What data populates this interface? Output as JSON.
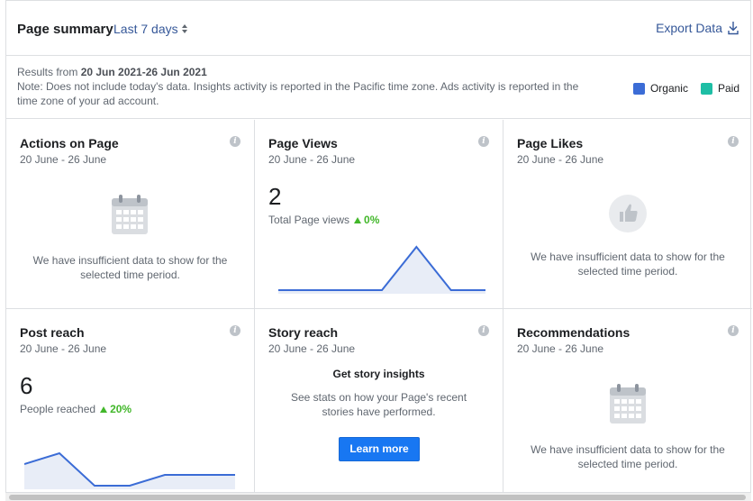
{
  "header": {
    "title": "Page summary",
    "range_label": "Last 7 days",
    "export_label": "Export Data"
  },
  "info": {
    "results_prefix": "Results from ",
    "results_range": "20 Jun 2021-26 Jun 2021",
    "note": "Note: Does not include today's data. Insights activity is reported in the Pacific time zone. Ads activity is reported in the time zone of your ad account."
  },
  "legend": {
    "organic": {
      "label": "Organic",
      "color": "#3b6cd6"
    },
    "paid": {
      "label": "Paid",
      "color": "#1ebea5"
    }
  },
  "cards": {
    "actions": {
      "title": "Actions on Page",
      "date": "20 June - 26 June",
      "insufficient": "We have insufficient data to show for the selected time period.",
      "icon": "calendar-icon"
    },
    "views": {
      "title": "Page Views",
      "date": "20 June - 26 June",
      "value": "2",
      "metric": "Total Page views",
      "delta": "0%",
      "series": [
        0,
        0,
        0,
        0,
        1,
        0,
        0
      ]
    },
    "likes": {
      "title": "Page Likes",
      "date": "20 June - 26 June",
      "insufficient": "We have insufficient data to show for the selected time period.",
      "icon": "thumbs-up-icon"
    },
    "reach": {
      "title": "Post reach",
      "date": "20 June - 26 June",
      "value": "6",
      "metric": "People reached",
      "delta": "20%",
      "series": [
        2,
        3,
        0,
        0,
        1,
        1,
        1
      ]
    },
    "story": {
      "title": "Story reach",
      "date": "20 June - 26 June",
      "heading": "Get story insights",
      "sub": "See stats on how your Page's recent stories have performed.",
      "button": "Learn more"
    },
    "recommendations": {
      "title": "Recommendations",
      "date": "20 June - 26 June",
      "insufficient": "We have insufficient data to show for the selected time period.",
      "icon": "calendar-icon"
    }
  },
  "info_icon_glyph": "i"
}
